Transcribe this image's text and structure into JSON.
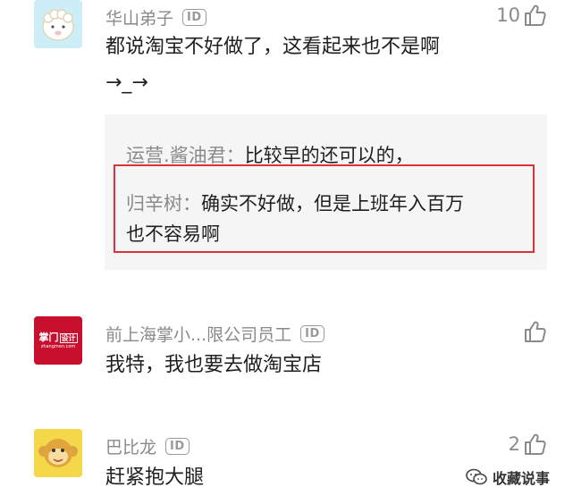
{
  "comments": [
    {
      "username": "华山弟子",
      "id_badge": "ID",
      "text_line1": "都说淘宝不好做了，这看起来也不是啊",
      "text_line2": "→_→",
      "likes": "10",
      "avatar_icon": "sheep-avatar-icon",
      "replies": [
        {
          "author": "运营.酱油君：",
          "text": "比较早的还可以的，"
        },
        {
          "author": "归辛树：",
          "text_line1": "确实不好做，但是上班年入百万",
          "text_line2": "也不容易啊"
        }
      ]
    },
    {
      "username": "前上海掌小...限公司员工",
      "id_badge": "ID",
      "text_line1": "我特，我也要去做淘宝店",
      "likes": "",
      "avatar_icon": "zhangmen-logo-avatar",
      "avatar_text": "掌门",
      "avatar_text2": "设计",
      "avatar_subtext": "zhangmen.com"
    },
    {
      "username": "巴比龙",
      "id_badge": "ID",
      "text_line1": "赶紧抱大腿",
      "likes": "2",
      "avatar_icon": "monkey-avatar-icon"
    }
  ],
  "watermark": {
    "text": "收藏说事",
    "icon": "wechat-logo-icon"
  },
  "colors": {
    "highlight_border": "#d8333b",
    "reply_bg": "#f5f5f5",
    "meta_gray": "#8a8a8a"
  }
}
